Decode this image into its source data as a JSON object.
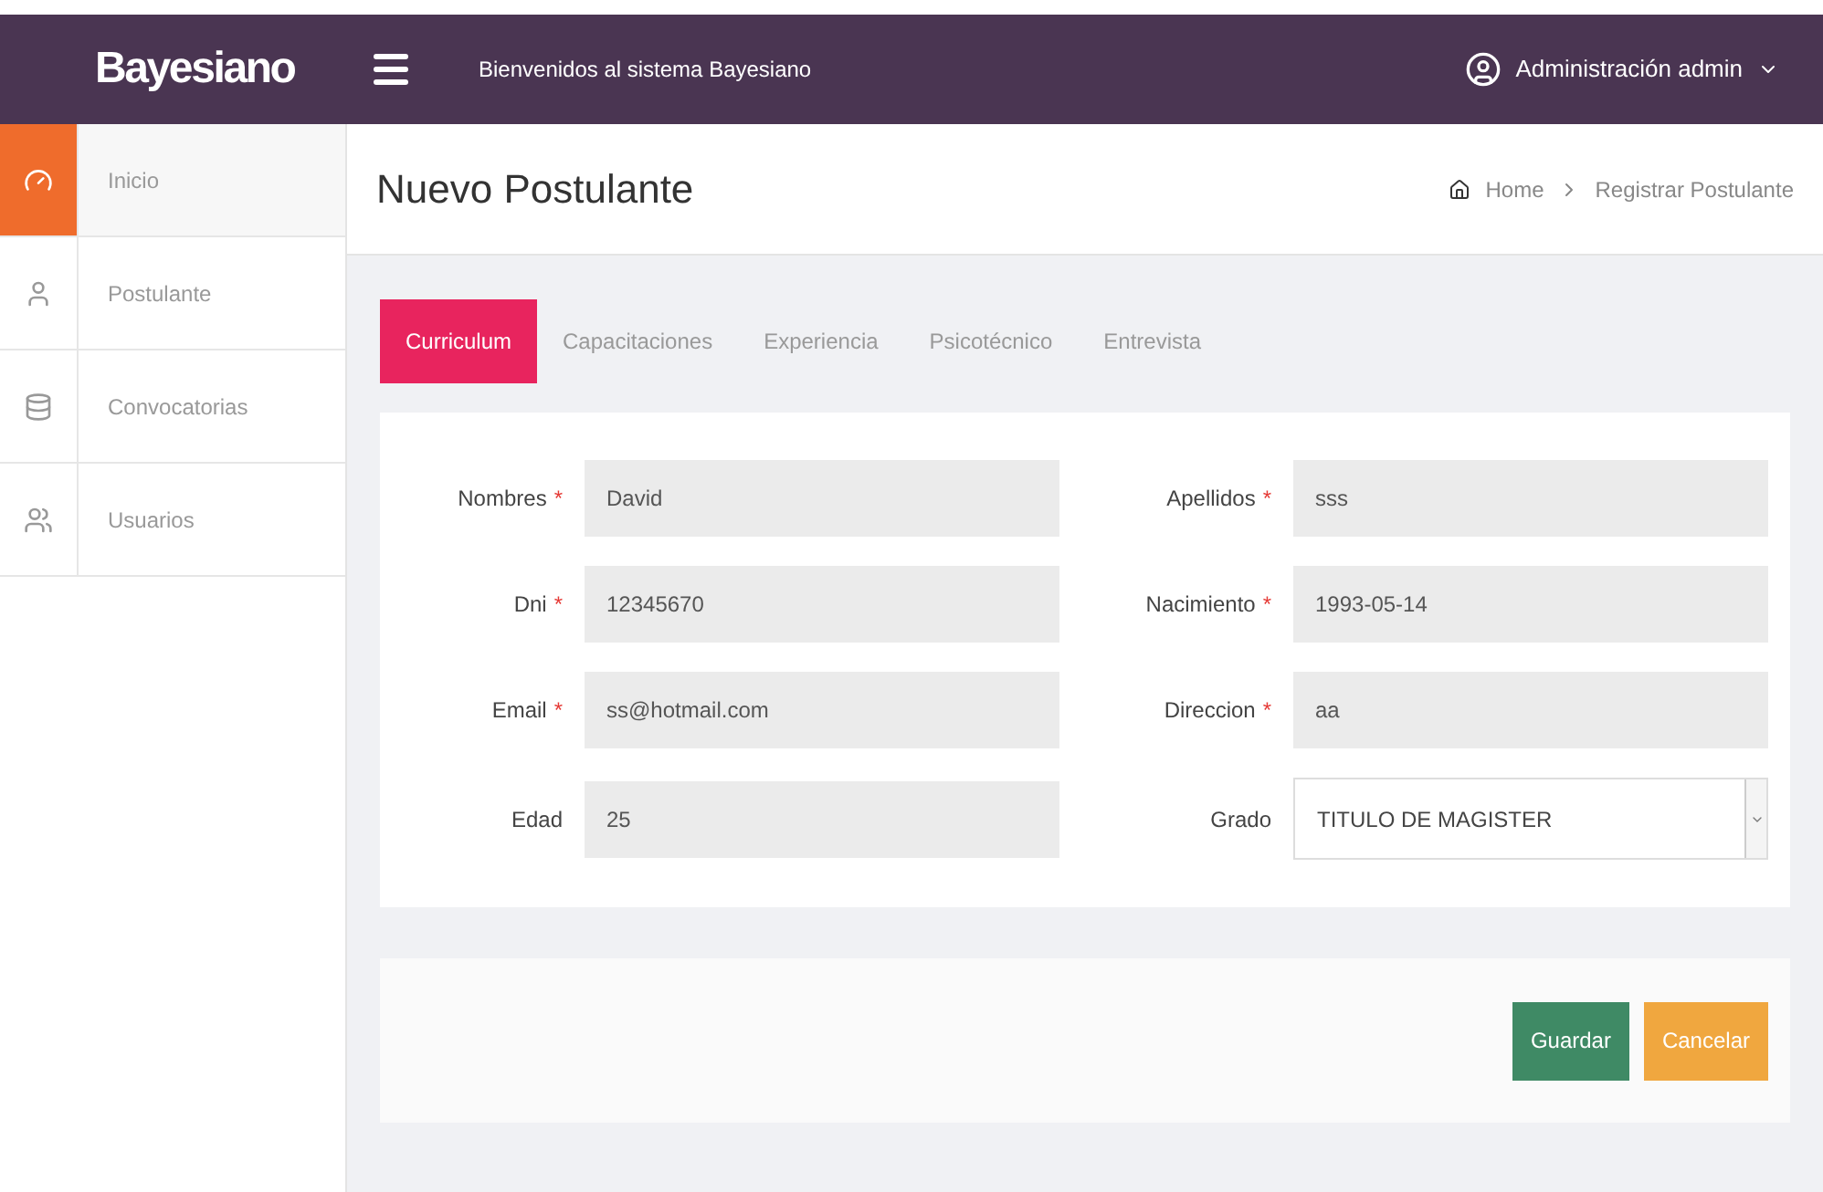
{
  "brand": "Bayesiano",
  "header": {
    "welcome": "Bienvenidos al sistema Bayesiano",
    "user": "Administración admin"
  },
  "sidebar": {
    "items": [
      {
        "label": "Inicio",
        "selected": true
      },
      {
        "label": "Postulante",
        "selected": false
      },
      {
        "label": "Convocatorias",
        "selected": false
      },
      {
        "label": "Usuarios",
        "selected": false
      }
    ]
  },
  "page_title": "Nuevo Postulante",
  "breadcrumb": [
    "Home",
    "Registrar Postulante"
  ],
  "tabs": [
    {
      "label": "Curriculum",
      "selected": true
    },
    {
      "label": "Capacitaciones",
      "selected": false
    },
    {
      "label": "Experiencia",
      "selected": false
    },
    {
      "label": "Psicotécnico",
      "selected": false
    },
    {
      "label": "Entrevista",
      "selected": false
    }
  ],
  "required_mark": "*",
  "fields": [
    {
      "label": "Nombres",
      "required": true,
      "value": "David",
      "kind": "input"
    },
    {
      "label": "Apellidos",
      "required": true,
      "value": "sss",
      "kind": "input"
    },
    {
      "label": "Dni",
      "required": true,
      "value": "12345670",
      "kind": "input"
    },
    {
      "label": "Nacimiento",
      "required": true,
      "value": "1993-05-14",
      "kind": "input"
    },
    {
      "label": "Email",
      "required": true,
      "value": "ss@hotmail.com",
      "kind": "input"
    },
    {
      "label": "Direccion",
      "required": true,
      "value": "aa",
      "kind": "input"
    },
    {
      "label": "Edad",
      "required": false,
      "value": "25",
      "kind": "input"
    },
    {
      "label": "Grado",
      "required": false,
      "value": "TITULO DE MAGISTER",
      "kind": "select"
    }
  ],
  "buttons": [
    {
      "label": "Guardar",
      "kind": "primary"
    },
    {
      "label": "Cancelar",
      "kind": "warning"
    }
  ]
}
